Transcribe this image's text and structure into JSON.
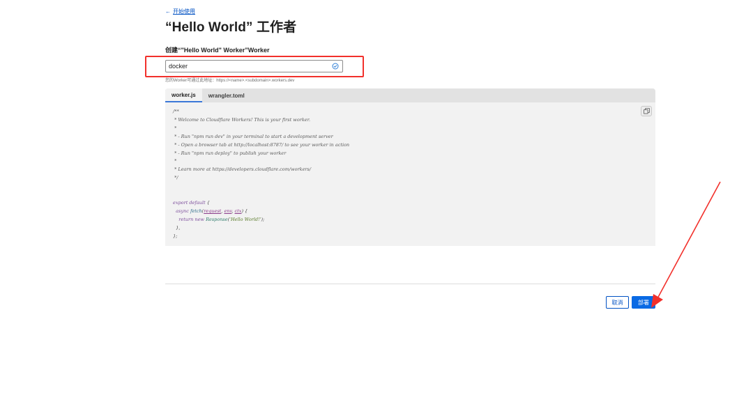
{
  "nav": {
    "back_arrow": "←",
    "back_label": "开始使用"
  },
  "page": {
    "title": "“Hello World” 工作者"
  },
  "form": {
    "label": "创建“\"Hello World\" Worker”Worker",
    "name_value": "docker",
    "url_hint": "您的Worker可通过此地址：https://<name>.<subdomain>.workers.dev"
  },
  "editor": {
    "tabs": [
      {
        "label": "worker.js",
        "active": true
      },
      {
        "label": "wrangler.toml",
        "active": false
      }
    ],
    "code_lines": [
      "/**",
      " * Welcome to Cloudflare Workers! This is your first worker.",
      " *",
      " * - Run \"npm run dev\" in your terminal to start a development server",
      " * - Open a browser tab at http://localhost:8787/ to see your worker in action",
      " * - Run \"npm run deploy\" to publish your worker",
      " *",
      " * Learn more at https://developers.cloudflare.com/workers/",
      " */",
      "",
      "",
      "export default {",
      "  async fetch(request, env, ctx) {",
      "    return new Response('Hello World!');",
      "  },",
      "};"
    ]
  },
  "actions": {
    "cancel_label": "取消",
    "deploy_label": "部署"
  },
  "colors": {
    "link": "#0051c3",
    "primary": "#0a6ae4",
    "annotation": "#f2302b",
    "check": "#2f7fd6"
  },
  "icons": {
    "check": "check-circle-icon",
    "copy": "copy-icon",
    "back": "arrow-left-icon"
  }
}
